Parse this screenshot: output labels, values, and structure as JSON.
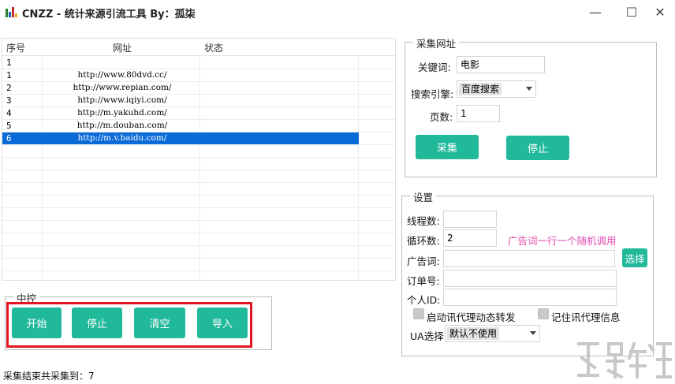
{
  "window": {
    "title": "CNZZ - 统计来源引流工具 By：孤柒",
    "minimize": "—",
    "maximize": "☐",
    "close": "✕"
  },
  "table": {
    "headers": [
      "序号",
      "网址",
      "状态"
    ],
    "rows": [
      {
        "idx": "1",
        "url": ""
      },
      {
        "idx": "1",
        "url": "http://www.80dvd.cc/"
      },
      {
        "idx": "2",
        "url": "http://www.repian.com/"
      },
      {
        "idx": "3",
        "url": "http://www.iqiyi.com/"
      },
      {
        "idx": "4",
        "url": "http://m.yakuhd.com/"
      },
      {
        "idx": "5",
        "url": "http://m.douban.com/"
      },
      {
        "idx": "6",
        "url": "http://m.v.baidu.com/"
      }
    ]
  },
  "collect": {
    "group_title": "采集网址",
    "keyword_label": "关键词:",
    "keyword_value": "电影",
    "engine_label": "搜索引擎:",
    "engine_value": "百度搜索",
    "pages_label": "页数:",
    "pages_value": "1",
    "collect_btn": "采集",
    "stop_btn": "停止"
  },
  "settings": {
    "group_title": "设置",
    "threads_label": "线程数:",
    "threads_value": "",
    "loops_label": "循环数:",
    "loops_value": "2",
    "hint": "广告词一行一个随机调用",
    "ad_label": "广告词:",
    "ad_value": "",
    "choose_btn": "选择",
    "order_label": "订单号:",
    "order_value": "",
    "personal_label": "个人ID:",
    "personal_value": "",
    "proxy_dynamic": "启动讯代理动态转发",
    "proxy_remember": "记住讯代理信息",
    "ua_label": "UA选择:",
    "ua_value": "默认不使用"
  },
  "control": {
    "group_title": "中控",
    "start": "开始",
    "stop": "停止",
    "clear": "清空",
    "import": "导入"
  },
  "status_text": "采集结束共采集到：7",
  "colors": {
    "accent": "#20b99a",
    "selection": "#0a6ad8",
    "highlight_box": "#e0171f",
    "hint": "#e04bb0"
  }
}
